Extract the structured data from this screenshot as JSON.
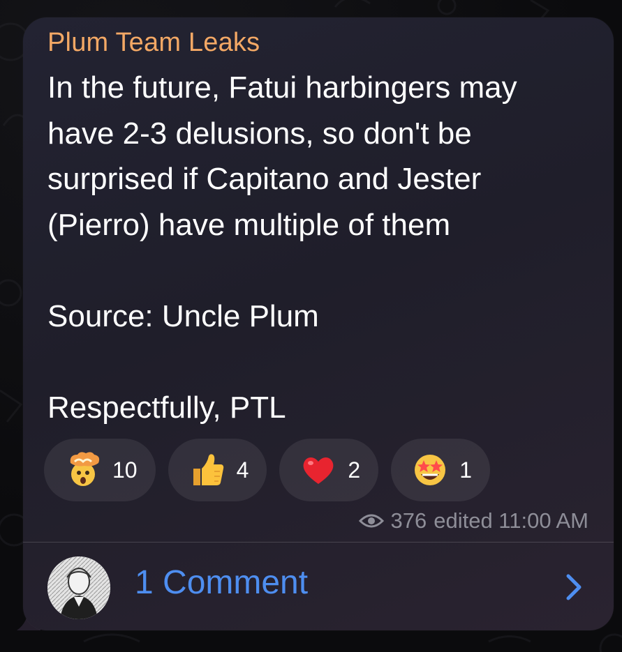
{
  "message": {
    "sender": "Plum Team Leaks",
    "lines": [
      "In the future, Fatui harbingers may",
      "have 2-3 delusions, so don't be",
      "surprised if Capitano and Jester",
      "(Pierro) have multiple of them",
      "",
      "Source: Uncle Plum",
      "",
      "Respectfully, PTL"
    ],
    "text": "In the future, Fatui harbingers may\nhave 2-3 delusions, so don't be\nsurprised if Capitano and Jester\n(Pierro) have multiple of them\n\nSource: Uncle Plum\n\nRespectfully, PTL",
    "views": "376",
    "status": "edited 11:00 AM"
  },
  "reactions": [
    {
      "emoji": "exploding-head-icon",
      "count": "10"
    },
    {
      "emoji": "thumbs-up-icon",
      "count": "4"
    },
    {
      "emoji": "heart-icon",
      "count": "2"
    },
    {
      "emoji": "star-struck-icon",
      "count": "1"
    }
  ],
  "comments": {
    "label": "1 Comment"
  },
  "colors": {
    "sender": "#f3a865",
    "link": "#4e8ef0",
    "meta": "#8e8e98",
    "bubble": "#232332"
  }
}
